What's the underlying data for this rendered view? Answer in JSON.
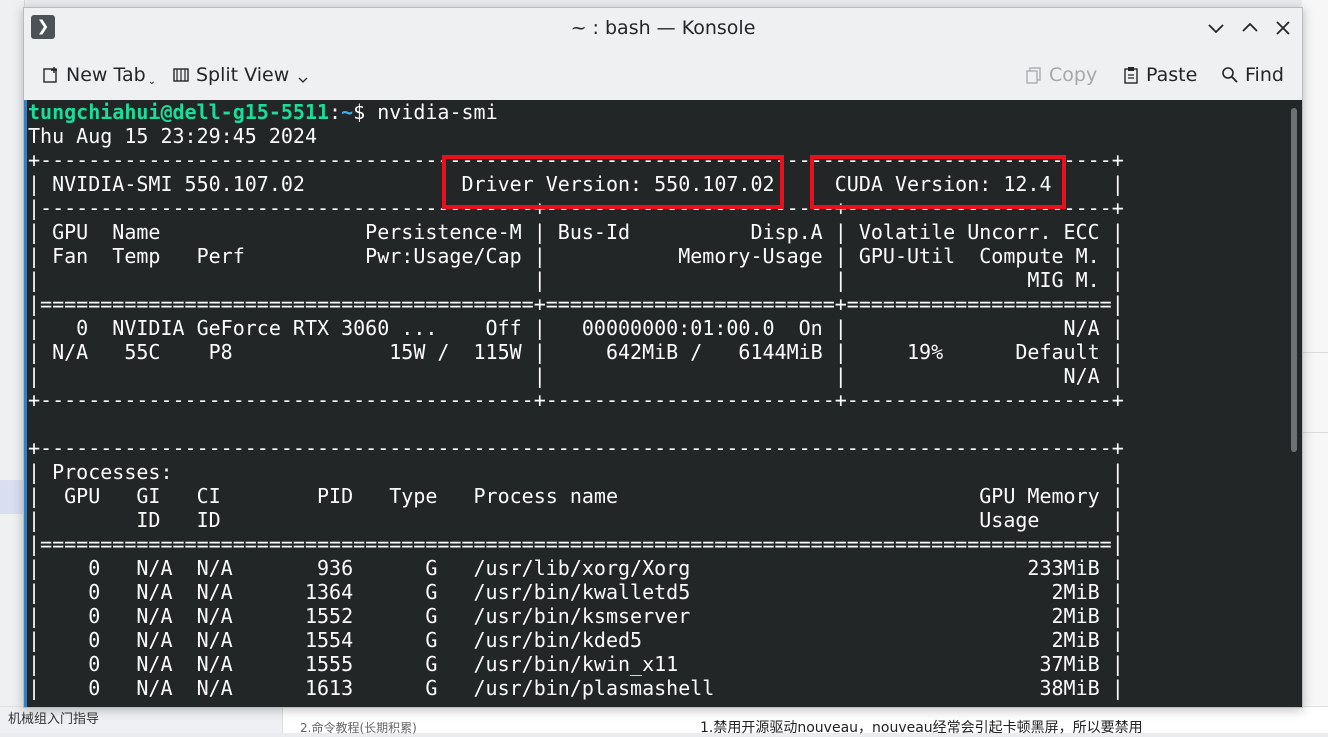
{
  "background": {
    "left_text": "机械组入门指导",
    "bottom_mid_text": "2.命令教程(长期积累)",
    "bottom_right_text": "1.禁用开源驱动nouveau，nouveau经常会引起卡顿黑屏，所以要禁用"
  },
  "window": {
    "title": "~ : bash — Konsole",
    "menu_icon": "chevron-right-icon"
  },
  "toolbar": {
    "new_tab": "New Tab",
    "split_view": "Split View",
    "copy": "Copy",
    "paste": "Paste",
    "find": "Find"
  },
  "terminal": {
    "prompt_user": "tungchiahui@dell-g15-5511",
    "prompt_colon": ":",
    "prompt_path": "~",
    "prompt_symbol": "$ ",
    "command": "nvidia-smi",
    "lines": [
      "Thu Aug 15 23:29:45 2024",
      "+-----------------------------------------------------------------------------------------+",
      "| NVIDIA-SMI 550.107.02             Driver Version: 550.107.02     CUDA Version: 12.4     |",
      "|-----------------------------------------+------------------------+----------------------+",
      "| GPU  Name                 Persistence-M | Bus-Id          Disp.A | Volatile Uncorr. ECC |",
      "| Fan  Temp   Perf          Pwr:Usage/Cap |           Memory-Usage | GPU-Util  Compute M. |",
      "|                                         |                        |               MIG M. |",
      "|=========================================+========================+======================|",
      "|   0  NVIDIA GeForce RTX 3060 ...    Off |   00000000:01:00.0  On |                  N/A |",
      "| N/A   55C    P8             15W /  115W |     642MiB /   6144MiB |     19%      Default |",
      "|                                         |                        |                  N/A |",
      "+-----------------------------------------+------------------------+----------------------+",
      "",
      "+-----------------------------------------------------------------------------------------+",
      "| Processes:                                                                              |",
      "|  GPU   GI   CI        PID   Type   Process name                              GPU Memory |",
      "|        ID   ID                                                               Usage      |",
      "|=========================================================================================|",
      "|    0   N/A  N/A       936      G   /usr/lib/xorg/Xorg                            233MiB |",
      "|    0   N/A  N/A      1364      G   /usr/bin/kwalletd5                              2MiB |",
      "|    0   N/A  N/A      1552      G   /usr/bin/ksmserver                              2MiB |",
      "|    0   N/A  N/A      1554      G   /usr/bin/kded5                                  2MiB |",
      "|    0   N/A  N/A      1555      G   /usr/bin/kwin_x11                              37MiB |",
      "|    0   N/A  N/A      1613      G   /usr/bin/plasmashell                           38MiB |"
    ]
  },
  "colors": {
    "terminal_bg": "#232627",
    "prompt_user": "#1cdc9a",
    "prompt_path": "#3daee9",
    "highlight": "#e8101c"
  }
}
